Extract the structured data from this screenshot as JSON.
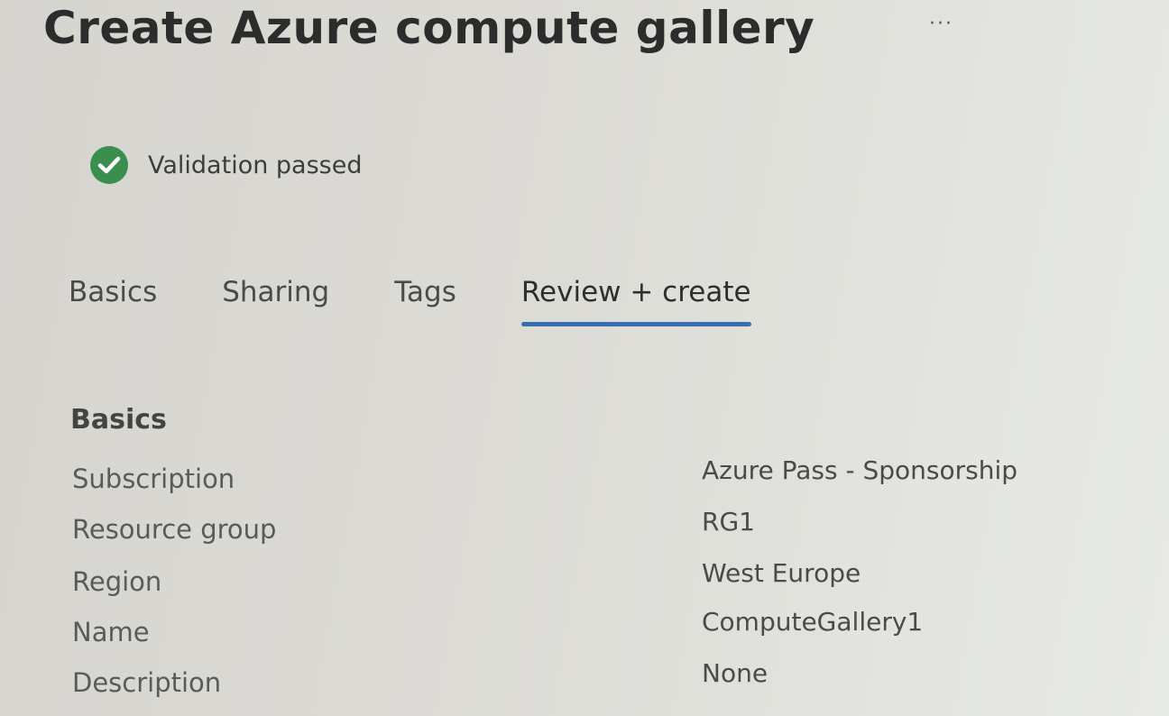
{
  "header": {
    "title": "Create Azure compute gallery",
    "more_label": "···"
  },
  "validation": {
    "icon": "checkmark-circle-icon",
    "status_color": "#3a8f4f",
    "text": "Validation passed"
  },
  "tabs": [
    {
      "label": "Basics",
      "active": false
    },
    {
      "label": "Sharing",
      "active": false
    },
    {
      "label": "Tags",
      "active": false
    },
    {
      "label": "Review + create",
      "active": true
    }
  ],
  "accent_color": "#3a6eb0",
  "summary": {
    "heading": "Basics",
    "rows": [
      {
        "label": "Subscription",
        "value": "Azure Pass - Sponsorship"
      },
      {
        "label": "Resource group",
        "value": "RG1"
      },
      {
        "label": "Region",
        "value": "West Europe"
      },
      {
        "label": "Name",
        "value": "ComputeGallery1"
      },
      {
        "label": "Description",
        "value": "None"
      }
    ]
  }
}
